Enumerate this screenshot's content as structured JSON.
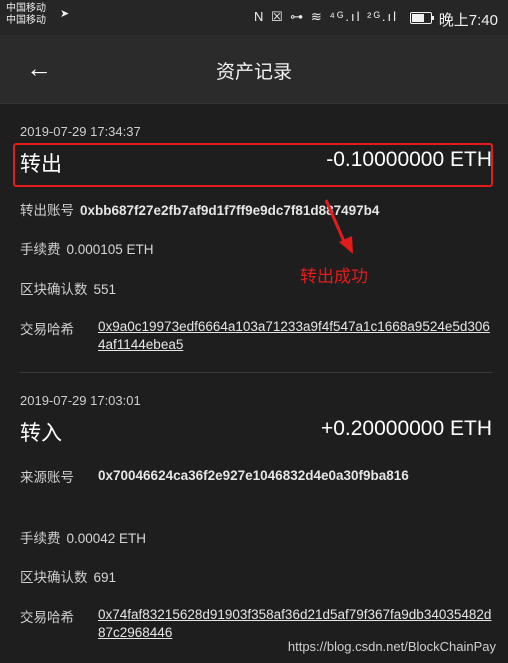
{
  "status_bar": {
    "carrier1": "中国移动",
    "carrier2": "中国移动",
    "icons_text": "N ☒ ⊶ ≋ ⁴ᴳ.ıl ²ᴳ.ıl",
    "time": "晚上7:40"
  },
  "header": {
    "back_icon": "←",
    "title": "资产记录"
  },
  "records": [
    {
      "time": "2019-07-29 17:34:37",
      "type": "转出",
      "amount": "-0.10000000 ETH",
      "account_label": "转出账号",
      "account": "0xbb687f27e2fb7af9d1f7ff9e9dc7f81d887497b4",
      "fee_label": "手续费",
      "fee": "0.000105 ETH",
      "confirm_label": "区块确认数",
      "confirmations": "551",
      "hash_label": "交易哈希",
      "hash": "0x9a0c19973edf6664a103a71233a9f4f547a1c1668a9524e5d3064af1144ebea5"
    },
    {
      "time": "2019-07-29 17:03:01",
      "type": "转入",
      "amount": "+0.20000000 ETH",
      "account_label": "来源账号",
      "account": "0x70046624ca36f2e927e1046832d4e0a30f9ba816",
      "fee_label": "手续费",
      "fee": "0.00042 ETH",
      "confirm_label": "区块确认数",
      "confirmations": "691",
      "hash_label": "交易哈希",
      "hash": "0x74faf83215628d91903f358af36d21d5af79f367fa9db34035482d87c2968446"
    }
  ],
  "annotation": {
    "note": "转出成功",
    "color": "#e31b1b"
  },
  "watermark": "https://blog.csdn.net/BlockChainPay"
}
